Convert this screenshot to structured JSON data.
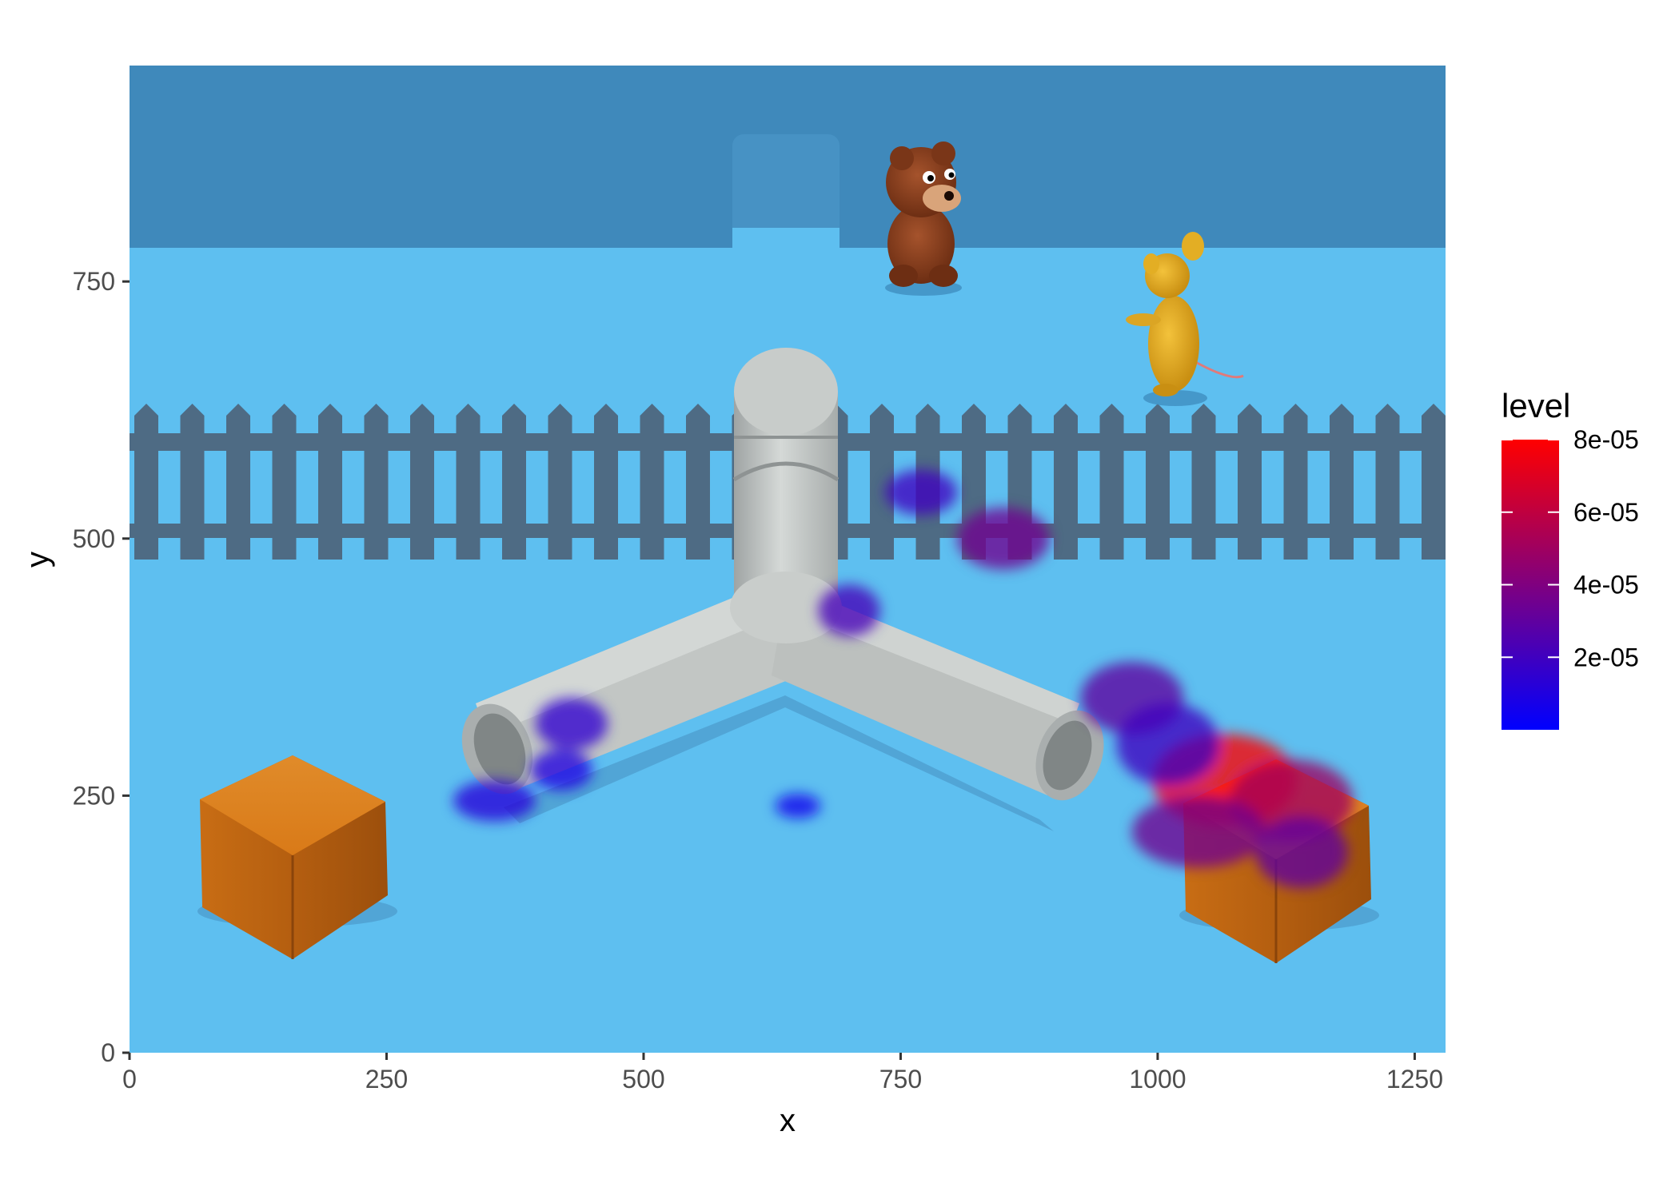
{
  "chart_data": {
    "type": "heatmap",
    "title": "",
    "xlabel": "x",
    "ylabel": "y",
    "xlim": [
      0,
      1280
    ],
    "ylim": [
      0,
      960
    ],
    "x_ticks": [
      0,
      250,
      500,
      750,
      1000,
      1250
    ],
    "y_ticks": [
      0,
      250,
      500,
      750
    ],
    "x_tick_labels": [
      "0",
      "250",
      "500",
      "750",
      "1000",
      "1250"
    ],
    "y_tick_labels": [
      "0",
      "250",
      "500",
      "750"
    ],
    "background_image": "game-scene: light-blue floor, dark-blue back wall with doorway, grey picket fence, grey Y-shaped tunnel, two orange boxes, brown bear, yellow mouse",
    "legend": {
      "title": "level",
      "position": "right",
      "colors": [
        "#0000ff",
        "#ff0000"
      ],
      "range": [
        0,
        8e-05
      ],
      "ticks": [
        2e-05,
        4e-05,
        6e-05,
        8e-05
      ],
      "tick_labels": [
        "2e-05",
        "4e-05",
        "6e-05",
        "8e-05"
      ]
    },
    "density_blobs": [
      {
        "x": 1065,
        "y": 265,
        "sx": 70,
        "sy": 45,
        "level": 8e-05
      },
      {
        "x": 1130,
        "y": 245,
        "sx": 60,
        "sy": 40,
        "level": 5e-05
      },
      {
        "x": 1040,
        "y": 215,
        "sx": 65,
        "sy": 35,
        "level": 3.5e-05
      },
      {
        "x": 1140,
        "y": 195,
        "sx": 45,
        "sy": 35,
        "level": 3e-05
      },
      {
        "x": 975,
        "y": 345,
        "sx": 50,
        "sy": 35,
        "level": 3e-05
      },
      {
        "x": 1010,
        "y": 300,
        "sx": 50,
        "sy": 40,
        "level": 2e-05
      },
      {
        "x": 850,
        "y": 500,
        "sx": 45,
        "sy": 30,
        "level": 3.5e-05
      },
      {
        "x": 770,
        "y": 545,
        "sx": 35,
        "sy": 22,
        "level": 2e-05
      },
      {
        "x": 700,
        "y": 430,
        "sx": 30,
        "sy": 25,
        "level": 2.2e-05
      },
      {
        "x": 430,
        "y": 320,
        "sx": 35,
        "sy": 25,
        "level": 1.5e-05
      },
      {
        "x": 420,
        "y": 275,
        "sx": 30,
        "sy": 20,
        "level": 1e-05
      },
      {
        "x": 355,
        "y": 245,
        "sx": 40,
        "sy": 20,
        "level": 1.2e-05
      },
      {
        "x": 650,
        "y": 240,
        "sx": 22,
        "sy": 12,
        "level": 6e-06
      }
    ]
  }
}
